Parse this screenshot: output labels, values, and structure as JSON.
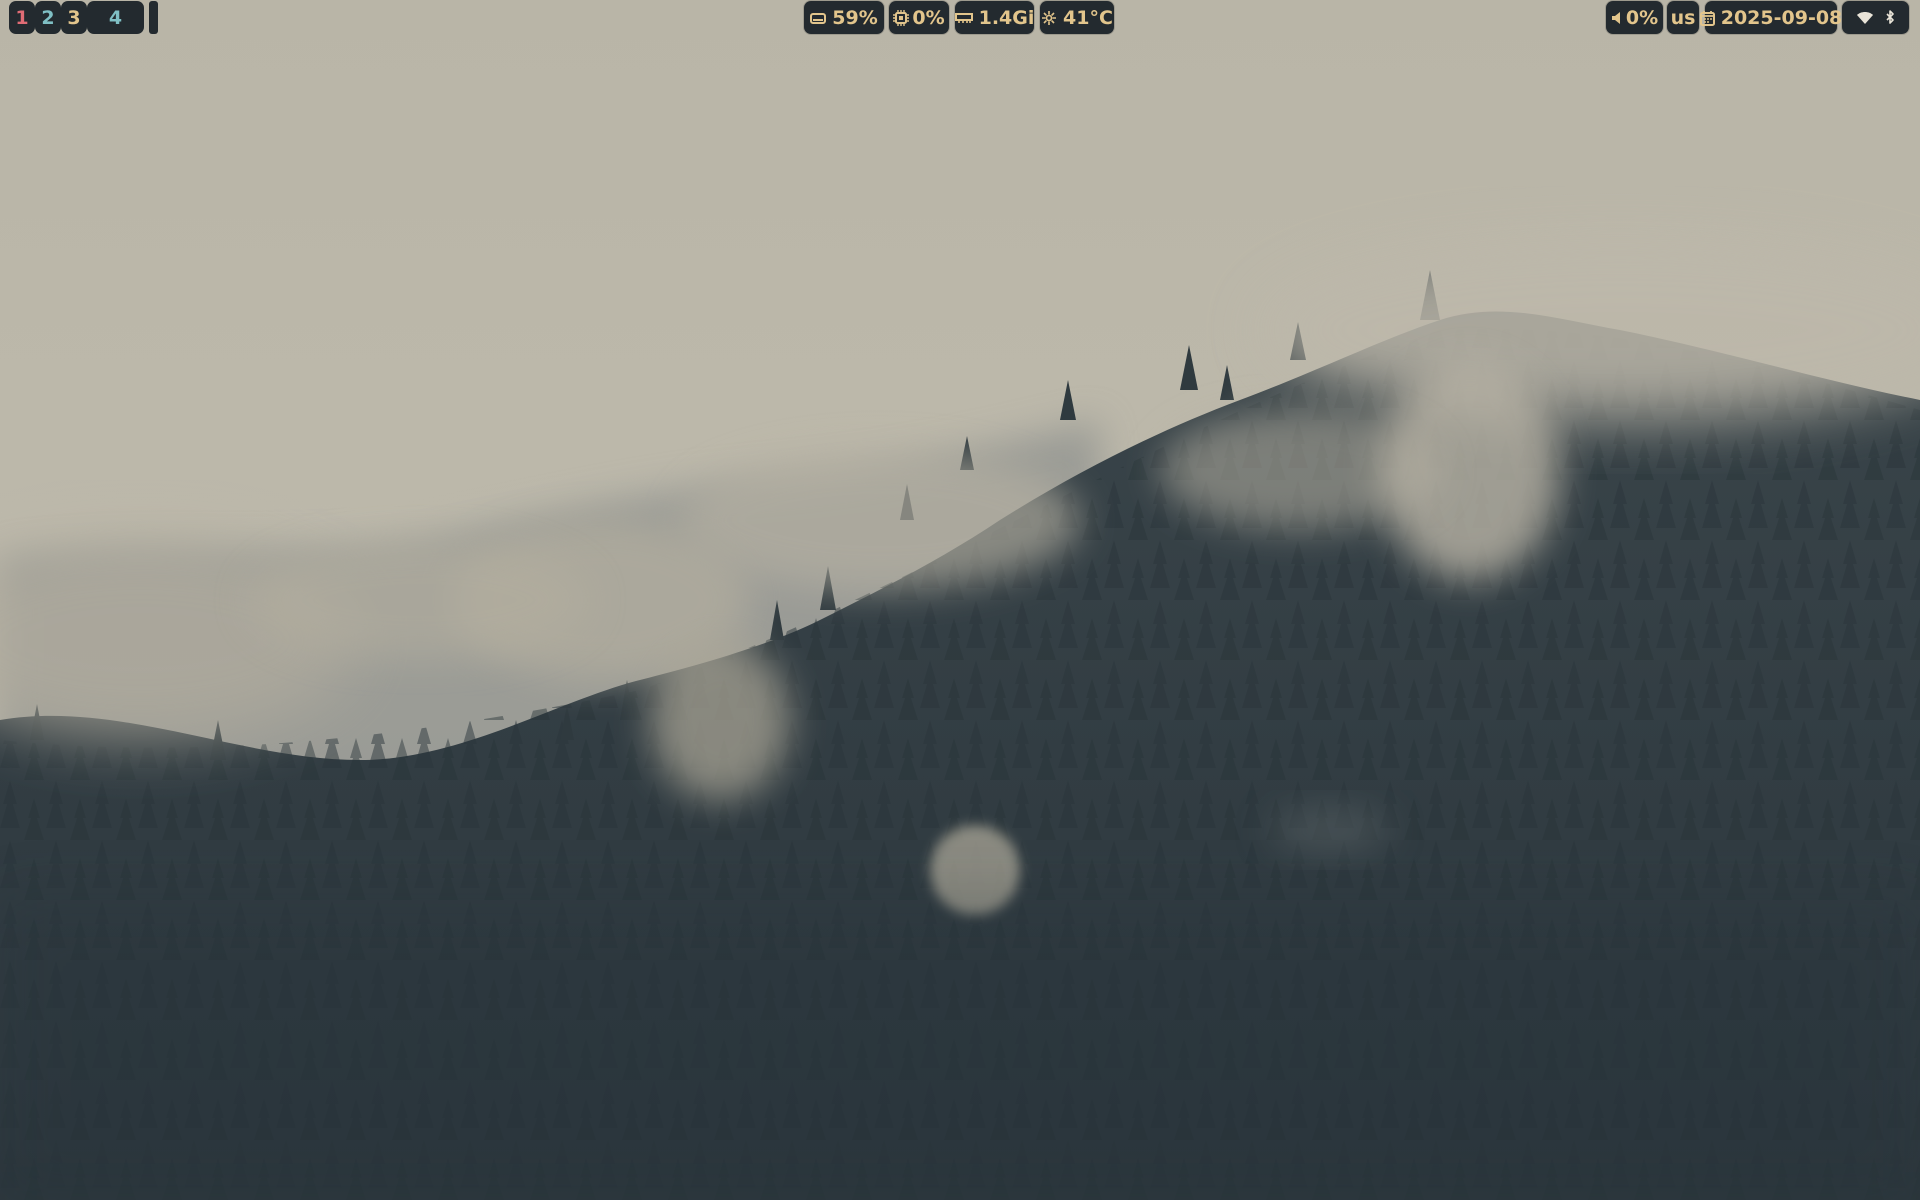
{
  "workspaces": [
    {
      "label": "1",
      "color": "#e06c75"
    },
    {
      "label": "2",
      "color": "#7fbfc4"
    },
    {
      "label": "3",
      "color": "#e2c58c"
    },
    {
      "label": "4",
      "color": "#7fbfc4"
    }
  ],
  "center_modules": {
    "disk": {
      "icon": "disk-icon",
      "value": "59%"
    },
    "cpu": {
      "icon": "cpu-icon",
      "value": "0%"
    },
    "memory": {
      "icon": "memory-icon",
      "value": "1.4Gi"
    },
    "temperature": {
      "icon": "thermometer-icon",
      "value": "41°C"
    }
  },
  "right_modules": {
    "volume": {
      "icon": "volume-icon",
      "value": "0%"
    },
    "keyboard_layout": {
      "value": "us"
    },
    "date": {
      "icon": "calendar-icon",
      "value": "2025-09-08"
    },
    "network": {
      "icon": "wifi-icon"
    },
    "bluetooth": {
      "icon": "bluetooth-icon"
    }
  },
  "colors": {
    "bar_pill_bg": "#232a2f",
    "text_accent": "#e2c58c",
    "sky": "#b7b3a6",
    "forest": "#2e3a40"
  }
}
